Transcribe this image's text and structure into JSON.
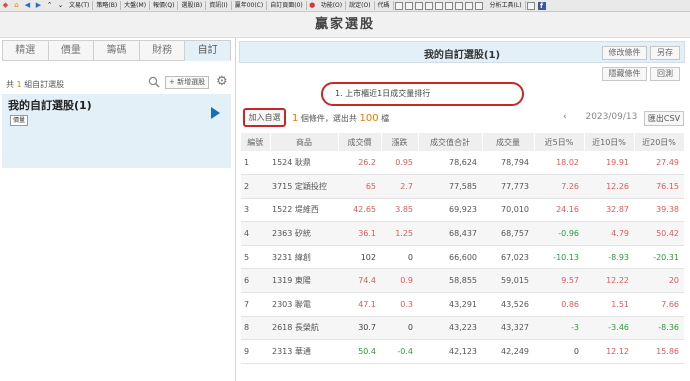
{
  "menubar": {
    "items": [
      "文易(T)",
      "策略(B)",
      "大盤(M)",
      "報價(Q)",
      "選股(B)",
      "資訊(I)",
      "贏年00(C)",
      "自訂頁面(0)",
      "功能(O)",
      "說定(O)",
      "代碼"
    ],
    "right_item": "分析工具(L)"
  },
  "app_title": "贏家選股",
  "left": {
    "tabs": [
      "精選",
      "價量",
      "籌碼",
      "財務",
      "自訂"
    ],
    "active_tab": "自訂",
    "group_count_prefix": "共",
    "group_count_num": "1",
    "group_count_suffix": "組自訂選股",
    "new_button": "+ 新增選股",
    "watch_title": "我的自訂選股(1)",
    "watch_badge": "價量"
  },
  "right": {
    "title": "我的自訂選股(1)",
    "buttons": {
      "edit": "修改條件",
      "save_as": "另存",
      "hide": "隱藏條件",
      "back": "回測"
    },
    "condition": "1. 上市櫃近1日成交量排行",
    "add_button": "加入自選",
    "summary_cond_num": "1",
    "summary_mid": "個條件，選出共",
    "summary_count": "100",
    "summary_unit": "檔",
    "date": "2023/09/13",
    "prev_icon": "chevron-left-icon",
    "next_icon": "chevron-right-icon",
    "export_button": "匯出CSV"
  },
  "table": {
    "headers": [
      "編號",
      "商品",
      "成交價",
      "漲跌",
      "成交值合計",
      "成交量",
      "近5日%",
      "近10日%",
      "近20日%"
    ],
    "rows": [
      {
        "no": "1",
        "name": "1524 耿鼎",
        "price": "26.2",
        "change": "0.95",
        "value": "78,624",
        "volume": "78,794",
        "d5": "18.02",
        "d10": "19.91",
        "d20": "27.49",
        "pc": "red",
        "c5": "red",
        "c10": "red",
        "c20": "red"
      },
      {
        "no": "2",
        "name": "3715 定穎投控",
        "price": "65",
        "change": "2.7",
        "value": "77,585",
        "volume": "77,773",
        "d5": "7.26",
        "d10": "12.26",
        "d20": "76.15",
        "pc": "red",
        "c5": "red",
        "c10": "red",
        "c20": "red"
      },
      {
        "no": "3",
        "name": "1522 堤維西",
        "price": "42.65",
        "change": "3.85",
        "value": "69,923",
        "volume": "70,010",
        "d5": "24.16",
        "d10": "32.87",
        "d20": "39.38",
        "pc": "red",
        "c5": "red",
        "c10": "red",
        "c20": "red"
      },
      {
        "no": "4",
        "name": "2363 矽統",
        "price": "36.1",
        "change": "1.25",
        "value": "68,437",
        "volume": "68,757",
        "d5": "-0.96",
        "d10": "4.79",
        "d20": "50.42",
        "pc": "red",
        "c5": "green",
        "c10": "red",
        "c20": "red"
      },
      {
        "no": "5",
        "name": "3231 緯創",
        "price": "102",
        "change": "0",
        "value": "66,600",
        "volume": "67,023",
        "d5": "-10.13",
        "d10": "-8.93",
        "d20": "-20.31",
        "pc": "black",
        "c5": "green",
        "c10": "green",
        "c20": "green"
      },
      {
        "no": "6",
        "name": "1319 東陽",
        "price": "74.4",
        "change": "0.9",
        "value": "58,855",
        "volume": "59,015",
        "d5": "9.57",
        "d10": "12.22",
        "d20": "20",
        "pc": "red",
        "c5": "red",
        "c10": "red",
        "c20": "red"
      },
      {
        "no": "7",
        "name": "2303 聯電",
        "price": "47.1",
        "change": "0.3",
        "value": "43,291",
        "volume": "43,526",
        "d5": "0.86",
        "d10": "1.51",
        "d20": "7.66",
        "pc": "red",
        "c5": "red",
        "c10": "red",
        "c20": "red"
      },
      {
        "no": "8",
        "name": "2618 長榮航",
        "price": "30.7",
        "change": "0",
        "value": "43,223",
        "volume": "43,327",
        "d5": "-3",
        "d10": "-3.46",
        "d20": "-8.36",
        "pc": "black",
        "c5": "green",
        "c10": "green",
        "c20": "green"
      },
      {
        "no": "9",
        "name": "2313 華通",
        "price": "50.4",
        "change": "-0.4",
        "value": "42,123",
        "volume": "42,249",
        "d5": "0",
        "d10": "12.12",
        "d20": "15.86",
        "pc": "green",
        "c5": "black",
        "c10": "red",
        "c20": "red"
      }
    ]
  },
  "colors": {
    "up": "#e05a5a",
    "down": "#2e9a3a",
    "accent": "#e4f0f8",
    "highlight": "#c62828",
    "count": "#e07a00"
  }
}
